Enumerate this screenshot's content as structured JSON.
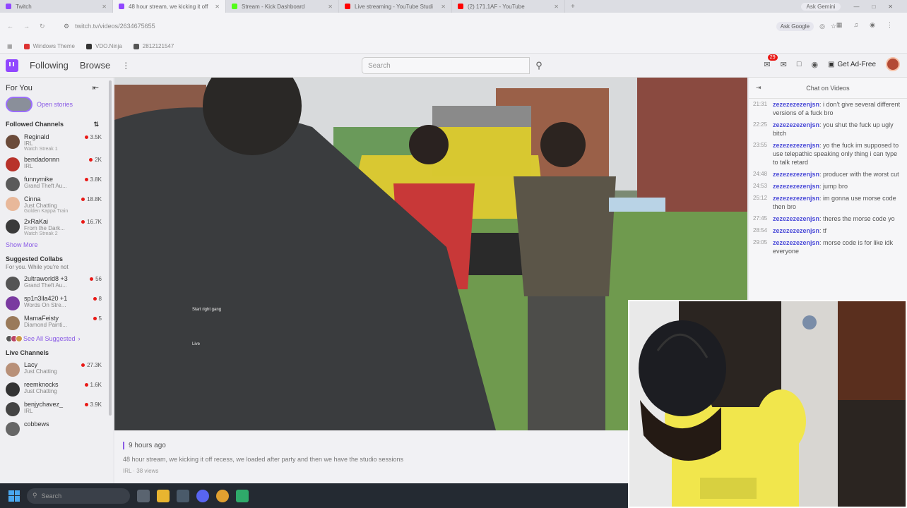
{
  "browser": {
    "tabs": [
      {
        "label": "Twitch",
        "color": "#9147ff",
        "active": false
      },
      {
        "label": "48 hour stream, we kicking it off",
        "color": "#9147ff",
        "active": true
      },
      {
        "label": "Stream - Kick Dashboard",
        "color": "#53fc18",
        "active": false
      },
      {
        "label": "Live streaming - YouTube Studi",
        "color": "#ff0000",
        "active": false
      },
      {
        "label": "(2) 171.1AF - YouTube",
        "color": "#ff0000",
        "active": false
      }
    ],
    "new_tab": "+",
    "ask_gemini": "Ask Gemini",
    "url": "twitch.tv/videos/2634675655",
    "ask_google": "Ask Google",
    "bookmarks": [
      {
        "label": "Windows Theme",
        "color": "#d33"
      },
      {
        "label": "VDO.Ninja",
        "color": "#333"
      },
      {
        "label": "2812121547",
        "color": "#555"
      }
    ]
  },
  "topnav": {
    "following": "Following",
    "browse": "Browse",
    "search_placeholder": "Search",
    "notif_count": "29",
    "get_ad_free": "Get Ad-Free"
  },
  "sidebar": {
    "for_you": "For You",
    "open_stories": "Open stories",
    "followed_title": "Followed Channels",
    "followed": [
      {
        "name": "Reginald",
        "game": "IRL",
        "extra": "Watch Streak 1",
        "viewers": "3.5K",
        "color": "#6b4b3a"
      },
      {
        "name": "bendadonnn",
        "game": "IRL",
        "extra": "",
        "viewers": "2K",
        "color": "#b8322a"
      },
      {
        "name": "funnymike",
        "game": "Grand Theft Au...",
        "extra": "",
        "viewers": "3.8K",
        "color": "#5a5a5a"
      },
      {
        "name": "Cinna",
        "game": "Just Chatting",
        "extra": "Golden Kappa Train",
        "viewers": "18.8K",
        "color": "#e8b89a"
      },
      {
        "name": "2xRaKai",
        "game": "From the Dark...",
        "extra": "Watch Streak 2",
        "viewers": "16.7K",
        "color": "#3a3a3a"
      }
    ],
    "show_more": "Show More",
    "suggested_title": "Suggested Collabs",
    "suggested_sub": "For you. While you're not",
    "suggested": [
      {
        "name": "2ultraworld8 +3",
        "game": "Grand Theft Au...",
        "viewers": "56",
        "color": "#555"
      },
      {
        "name": "sp1n3lla420 +1",
        "game": "Words On Stre...",
        "viewers": "8",
        "color": "#7a3aa0"
      },
      {
        "name": "MamaFeisty",
        "game": "Diamond Painti...",
        "viewers": "5",
        "color": "#9a7a5a"
      }
    ],
    "see_all": "See All Suggested",
    "live_title": "Live Channels",
    "live": [
      {
        "name": "Lacy",
        "game": "Just Chatting",
        "viewers": "27.3K",
        "color": "#b89078"
      },
      {
        "name": "reemknocks",
        "game": "Just Chatting",
        "viewers": "1.6K",
        "color": "#333"
      },
      {
        "name": "benjychavez_",
        "game": "IRL",
        "viewers": "3.9K",
        "color": "#444"
      },
      {
        "name": "cobbews",
        "game": "",
        "viewers": "",
        "color": "#666"
      }
    ]
  },
  "chat": {
    "title": "Chat on Videos",
    "messages": [
      {
        "ts": "21:31",
        "user": "zezezezezenjsn",
        "text": "i don't give several different versions of a fuck bro"
      },
      {
        "ts": "22:25",
        "user": "zezezezezenjsn",
        "text": "you shut the fuck up ugly bitch"
      },
      {
        "ts": "23:55",
        "user": "zezezezezenjsn",
        "text": "yo the fuck im supposed to use telepathic speaking only thing i can type to talk retard"
      },
      {
        "ts": "24:48",
        "user": "zezezezezenjsn",
        "text": "producer with the worst cut"
      },
      {
        "ts": "24:53",
        "user": "zezezezezenjsn",
        "text": "jump bro"
      },
      {
        "ts": "25:12",
        "user": "zezezezezenjsn",
        "text": "im gonna use morse code then bro"
      },
      {
        "ts": "27:45",
        "user": "zezezezezenjsn",
        "text": "theres the morse code yo"
      },
      {
        "ts": "28:54",
        "user": "zezezezezenjsn",
        "text": "tf"
      },
      {
        "ts": "29:05",
        "user": "zezezezezenjsn",
        "text": "morse code is for like idk everyone"
      }
    ]
  },
  "video": {
    "overlay_text_1": "Start right gang",
    "overlay_text_2": "Live"
  },
  "video_info": {
    "time_ago": "9 hours ago",
    "title": "48 hour stream, we kicking it off recess, we loaded after party and then we have the studio sessions",
    "meta": "IRL · 38 views"
  },
  "taskbar": {
    "search_placeholder": "Search"
  }
}
